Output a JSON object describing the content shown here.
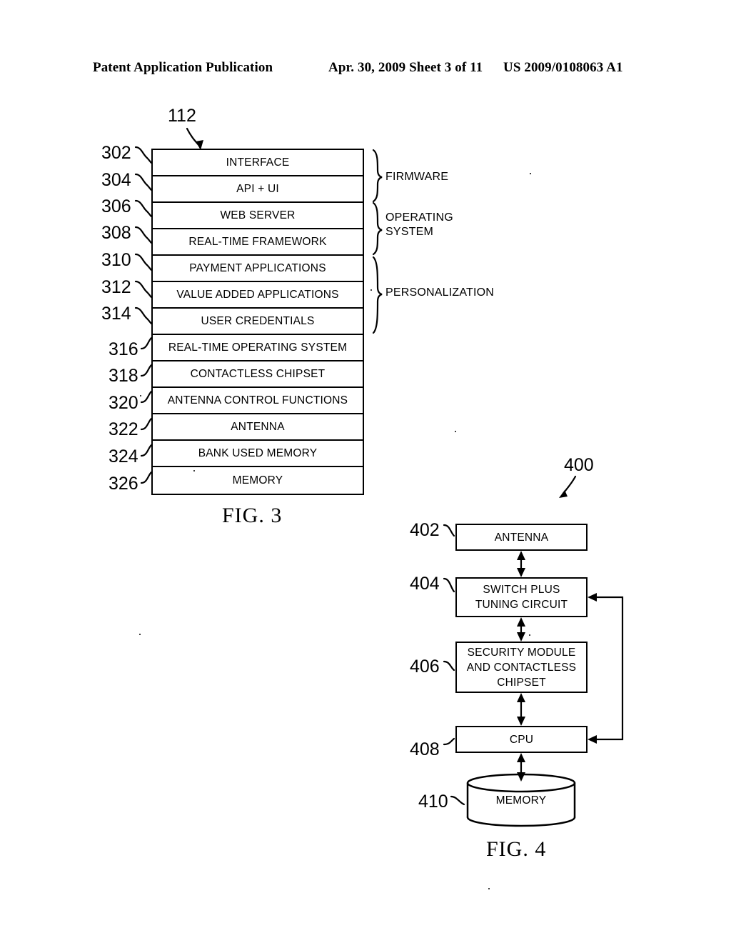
{
  "header": {
    "left": "Patent Application Publication",
    "middle": "Apr. 30, 2009  Sheet 3 of 11",
    "right": "US 2009/0108063 A1"
  },
  "fig3": {
    "caption": "FIG. 3",
    "assembly_ref": "112",
    "rows": [
      {
        "ref": "302",
        "label": "INTERFACE"
      },
      {
        "ref": "304",
        "label": "API + UI"
      },
      {
        "ref": "306",
        "label": "WEB SERVER"
      },
      {
        "ref": "308",
        "label": "REAL-TIME FRAMEWORK"
      },
      {
        "ref": "310",
        "label": "PAYMENT APPLICATIONS"
      },
      {
        "ref": "312",
        "label": "VALUE ADDED APPLICATIONS"
      },
      {
        "ref": "314",
        "label": "USER CREDENTIALS"
      },
      {
        "ref": "316",
        "label": "REAL-TIME OPERATING SYSTEM"
      },
      {
        "ref": "318",
        "label": "CONTACTLESS CHIPSET"
      },
      {
        "ref": "320",
        "label": "ANTENNA CONTROL FUNCTIONS"
      },
      {
        "ref": "322",
        "label": "ANTENNA"
      },
      {
        "ref": "324",
        "label": "BANK USED MEMORY"
      },
      {
        "ref": "326",
        "label": "MEMORY"
      }
    ],
    "braces": [
      {
        "label": "FIRMWARE",
        "line1": "FIRMWARE",
        "line2": ""
      },
      {
        "label": "OPERATING SYSTEM",
        "line1": "OPERATING",
        "line2": "SYSTEM"
      },
      {
        "label": "PERSONALIZATION",
        "line1": "PERSONALIZATION",
        "line2": ""
      }
    ]
  },
  "fig4": {
    "caption": "FIG. 4",
    "assembly_ref": "400",
    "blocks": [
      {
        "ref": "402",
        "line1": "ANTENNA",
        "line2": "",
        "line3": ""
      },
      {
        "ref": "404",
        "line1": "SWITCH PLUS",
        "line2": "TUNING CIRCUIT",
        "line3": ""
      },
      {
        "ref": "406",
        "line1": "SECURITY MODULE",
        "line2": "AND CONTACTLESS",
        "line3": "CHIPSET"
      },
      {
        "ref": "408",
        "line1": "CPU",
        "line2": "",
        "line3": ""
      },
      {
        "ref": "410",
        "line1": "MEMORY",
        "line2": "",
        "line3": ""
      }
    ]
  }
}
